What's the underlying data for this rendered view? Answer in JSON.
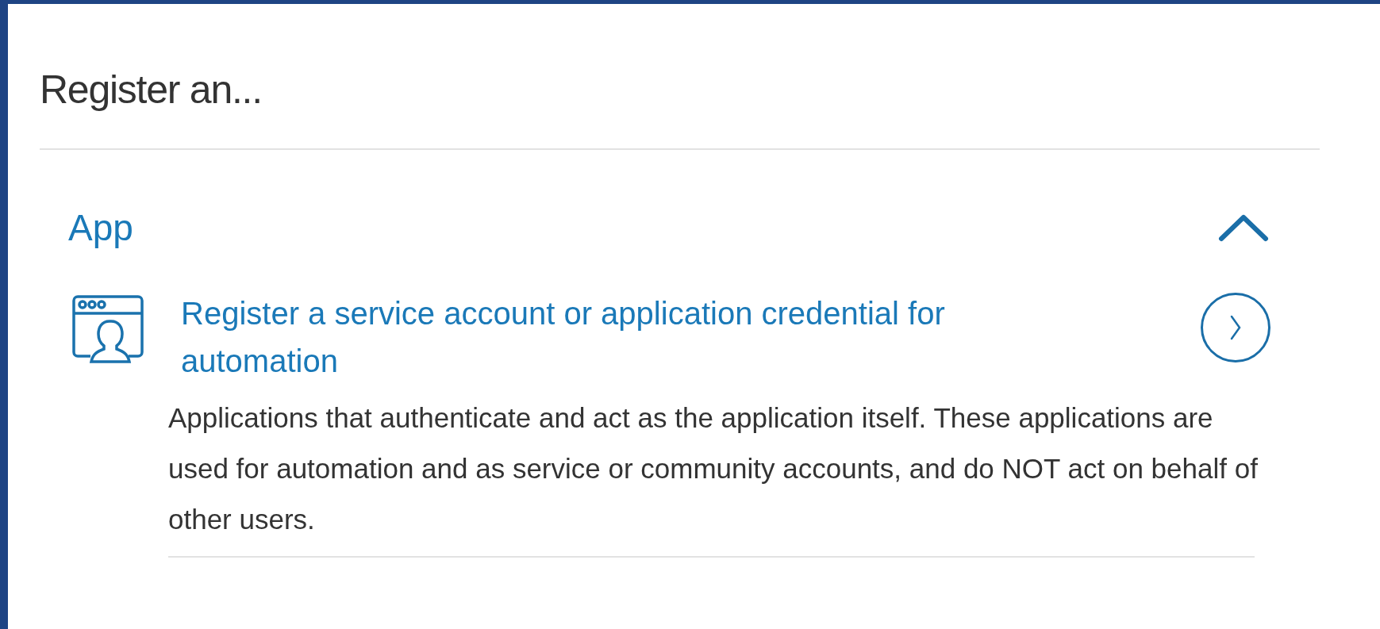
{
  "heading": "Register an...",
  "section": {
    "title": "App",
    "expanded": true,
    "options": [
      {
        "title": "Register a service account or application credential for automation",
        "description": "Applications that authenticate and act as the application itself. These applications are used for automation and as service or community accounts, and do NOT act on behalf of other users."
      }
    ]
  }
}
